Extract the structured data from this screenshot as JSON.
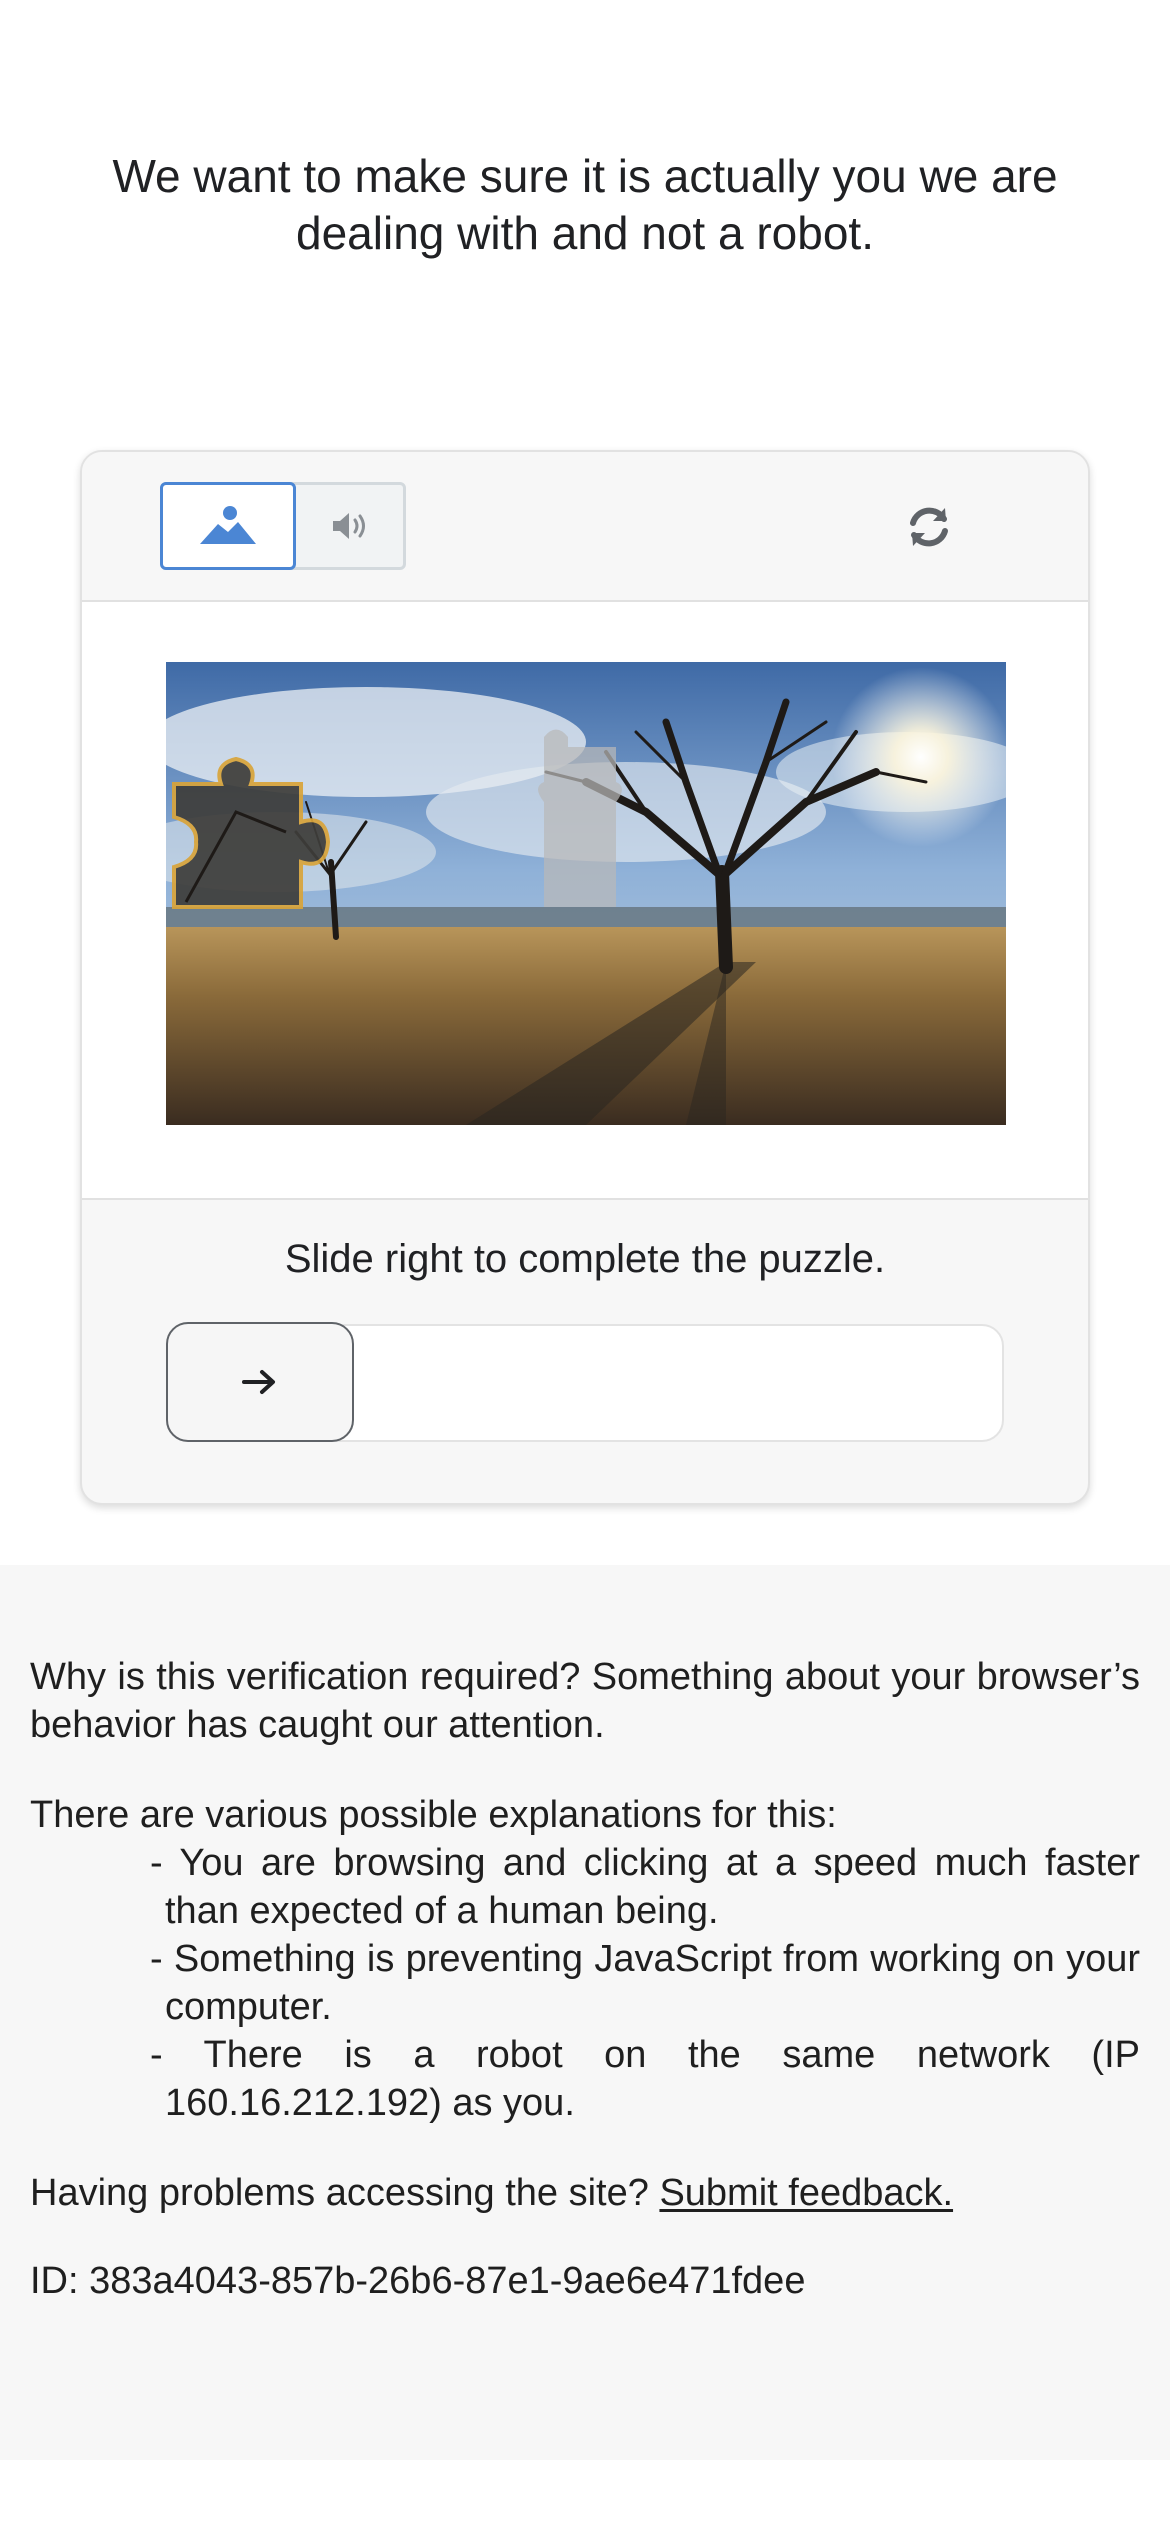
{
  "headline": "We want to make sure it is actually you we are dealing with and not a robot.",
  "card": {
    "mode_image_icon": "image-icon",
    "mode_audio_icon": "audio-icon",
    "refresh_icon": "refresh-icon",
    "instruction": "Slide right to complete the puzzle.",
    "slider_arrow_icon": "arrow-right-icon",
    "slider_progress": 0,
    "accent_color": "#4b86d4",
    "piece_outline_color": "#d9a43a"
  },
  "info": {
    "why_text": "Why is this verification required? Something about your browser’s behavior has caught our attention.",
    "explanations_intro": "There are various possible explanations for this:",
    "explanations": [
      "- You are browsing and clicking at a speed much faster than expected of a human being.",
      "- Something is preventing JavaScript from working on your computer.",
      "- There is a robot on the same network (IP 160.16.212.192) as you."
    ],
    "problems_text": "Having problems accessing the site?",
    "feedback_link": "Submit feedback.",
    "id_label": "ID:",
    "id_value": "383a4043-857b-26b6-87e1-9ae6e471fdee"
  }
}
